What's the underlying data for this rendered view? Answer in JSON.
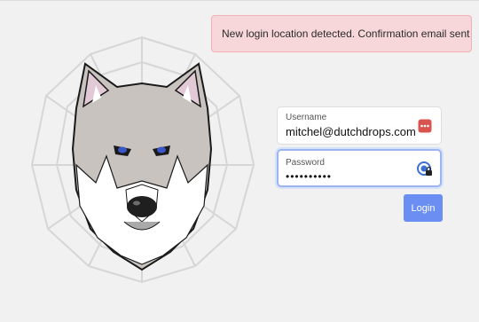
{
  "alert": {
    "text": "New login location detected. Confirmation email sent"
  },
  "logo": {
    "name": "wolf-spiderweb-logo"
  },
  "login_form": {
    "username": {
      "label": "Username",
      "value": "mitchel@dutchdrops.com",
      "icon": "password-manager-icon"
    },
    "password": {
      "label": "Password",
      "value": "••••••••••",
      "icon": "password-autofill-icon"
    },
    "submit_label": "Login"
  },
  "colors": {
    "alert_background": "#f8d7da",
    "button": "#6a8ef2",
    "focus_ring": "#9db5ee",
    "manager_icon": "#d9534f"
  }
}
